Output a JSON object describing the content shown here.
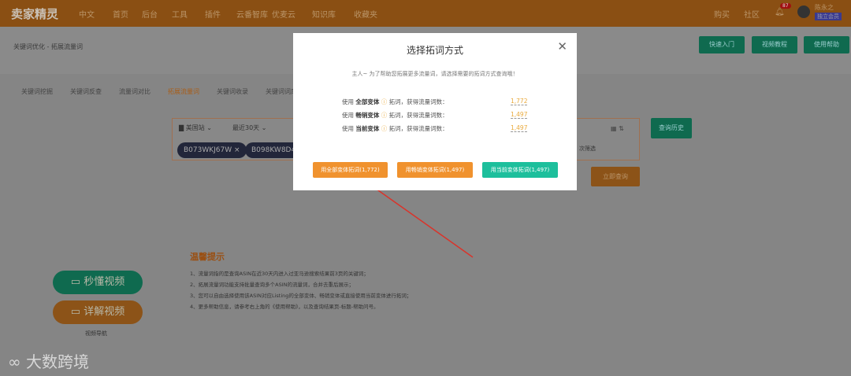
{
  "header": {
    "logo": "卖家精灵",
    "lang": "中文",
    "nav": [
      "首页",
      "后台",
      "工具",
      "插件",
      "云番智库",
      "优麦云",
      "知识库",
      "收藏夹"
    ],
    "right": [
      "购买",
      "社区"
    ],
    "notifications": "87",
    "user": "陈永之",
    "badge": "独立会员"
  },
  "breadcrumb": "关键词优化 - 拓展流量词",
  "tabs": [
    "关键词挖掘",
    "关键词反查",
    "流量词对比",
    "拓展流量词",
    "关键词收录",
    "关键词词库"
  ],
  "active_tab": 3,
  "top_buttons": [
    "快速入门",
    "视频教程",
    "使用帮助"
  ],
  "search": {
    "site": "美国站",
    "period": "最近30天",
    "chips": [
      "B073WKJ67W",
      "B098KW8D4F"
    ],
    "filter": "次筛选",
    "history": "查询历史",
    "query": "立即查询"
  },
  "modal": {
    "title": "选择拓词方式",
    "intro": "主人~ 为了帮助您拓展更多流量词，请选择需要的拓词方式查询哦！",
    "rows": [
      {
        "pre": "使用",
        "bold": "全部变体",
        "post": "拓词，获得流量词数：",
        "count": "1,772"
      },
      {
        "pre": "使用",
        "bold": "畅销变体",
        "post": "拓词，获得流量词数：",
        "count": "1,497"
      },
      {
        "pre": "使用",
        "bold": "当前变体",
        "post": "拓词，获得流量词数：",
        "count": "1,497"
      }
    ],
    "buttons": [
      "用全部变体拓词(1,772)",
      "用畅销变体拓词(1,497)",
      "用当前变体拓词(1,497)"
    ]
  },
  "tips": {
    "title": "温馨提示",
    "items": [
      "1、流量词指的是查询ASIN在近30天内进入过亚马逊搜索结果前3页的关键词；",
      "2、拓展流量词功能支持批量查询多个ASIN的流量词，合并去重后展示；",
      "3、您可以自由选择使用该ASIN对应Listing的全部变体、畅销变体或直接使用当前变体进行拓词；",
      "4、更多帮助信息，请参考右上角的《使用帮助》，以及查询结果页-标题-帮助问号。"
    ]
  },
  "videos": {
    "quick": "秒懂视频",
    "detail": "详解视频",
    "nav": "视频导航"
  },
  "watermark": "大数跨境",
  "colors": {
    "orange": "#f0922e",
    "green": "#1dbf9c",
    "header": "#8a4f13"
  }
}
